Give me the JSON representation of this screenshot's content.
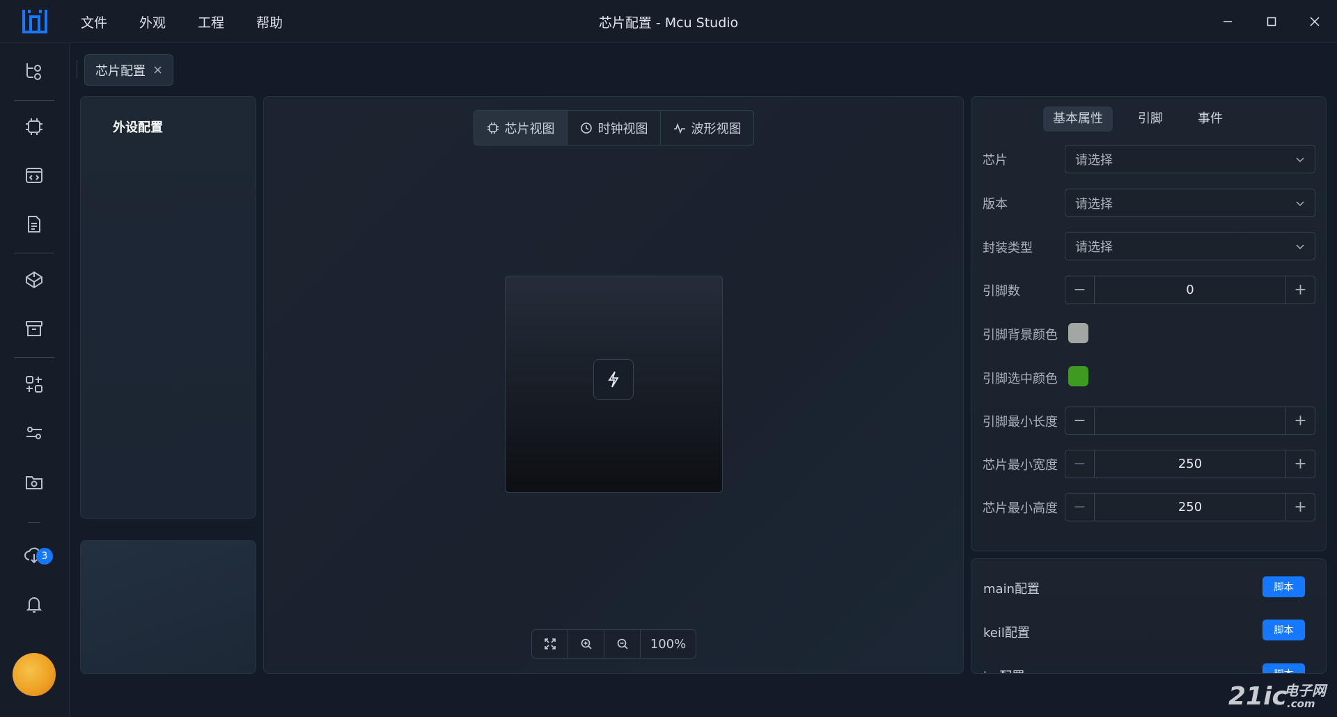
{
  "app": {
    "title": "芯片配置 - Mcu Studio",
    "menu": [
      "文件",
      "外观",
      "工程",
      "帮助"
    ]
  },
  "sidebar": {
    "icons": [
      "project-tree-icon",
      "chip-icon",
      "code-window-icon",
      "document-icon",
      "component-icon",
      "archive-icon",
      "module-icon",
      "settings-sliders-icon",
      "folder-camera-icon",
      "download-icon",
      "bell-icon"
    ],
    "notification_count": "3"
  },
  "tabs": [
    {
      "label": "芯片配置",
      "close": "×"
    }
  ],
  "left_panel": {
    "title": "外设配置"
  },
  "center": {
    "views": [
      "芯片视图",
      "时钟视图",
      "波形视图"
    ],
    "active_view": "芯片视图",
    "zoom": "100%"
  },
  "properties": {
    "tabs": [
      "基本属性",
      "引脚",
      "事件"
    ],
    "active_tab": "基本属性",
    "chip_label": "芯片",
    "chip_value": "请选择",
    "version_label": "版本",
    "version_value": "请选择",
    "package_label": "封装类型",
    "package_value": "请选择",
    "pin_count_label": "引脚数",
    "pin_count_value": "0",
    "pin_bg_color_label": "引脚背景颜色",
    "pin_bg_color": "#a3a7a3",
    "pin_sel_color_label": "引脚选中颜色",
    "pin_sel_color": "#3f9a22",
    "pin_min_len_label": "引脚最小长度",
    "pin_min_len_value": "",
    "chip_min_width_label": "芯片最小宽度",
    "chip_min_width_value": "250",
    "chip_min_height_label": "芯片最小高度",
    "chip_min_height_value": "250"
  },
  "scripts": {
    "rows": [
      {
        "label": "main配置",
        "button": "脚本"
      },
      {
        "label": "keil配置",
        "button": "脚本"
      },
      {
        "label": "iar配置",
        "button": "脚本"
      }
    ]
  },
  "watermark": {
    "brand": "21ic",
    "cn": "电子网",
    "com": ".com"
  },
  "colors": {
    "accent": "#1677ff",
    "background": "#131b28"
  }
}
